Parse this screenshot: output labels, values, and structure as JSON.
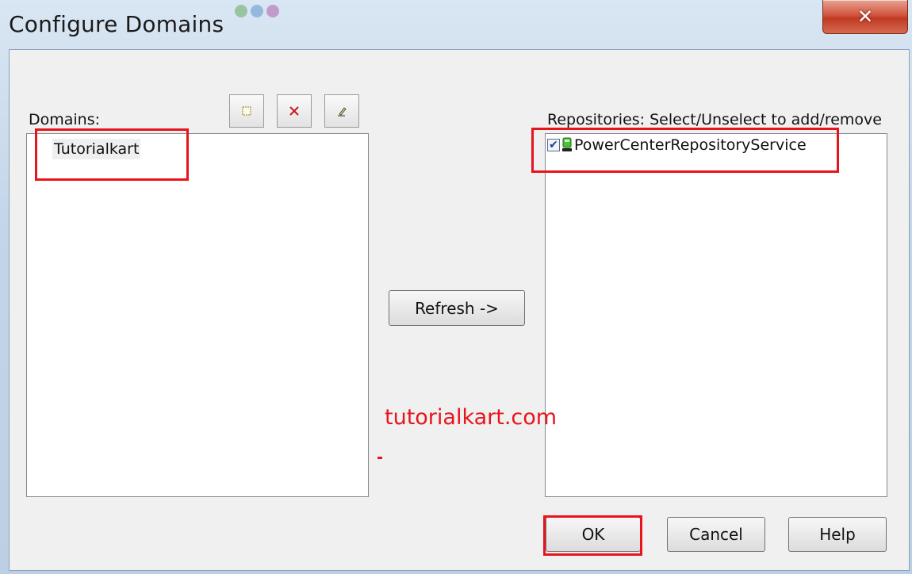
{
  "window": {
    "title": "Configure Domains",
    "close_label": "✕"
  },
  "domains": {
    "label": "Domains:",
    "items": [
      "Tutorialkart"
    ],
    "toolbar": {
      "add_icon": "new-domain-icon",
      "delete_icon": "delete-icon",
      "edit_icon": "edit-icon"
    }
  },
  "repositories": {
    "label": "Repositories: Select/Unselect to add/remove",
    "items": [
      {
        "name": "PowerCenterRepositoryService",
        "checked": true,
        "icon": "repository-service-icon"
      }
    ]
  },
  "buttons": {
    "refresh": "Refresh ->",
    "ok": "OK",
    "cancel": "Cancel",
    "help": "Help"
  },
  "watermark": "tutorialkart.com",
  "colors": {
    "highlight_red": "#e8141c",
    "close_button": "#c13a23"
  }
}
